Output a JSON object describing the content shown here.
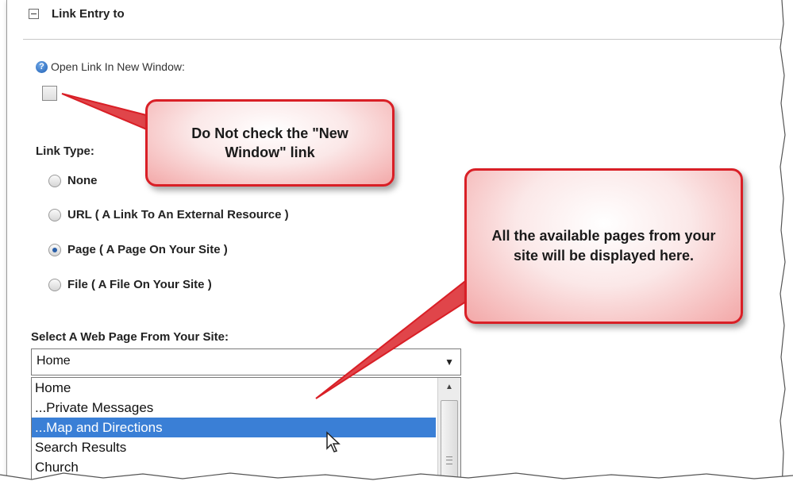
{
  "section": {
    "title": "Link Entry to",
    "collapse_icon": "minus-square-icon"
  },
  "new_window": {
    "label": "Open Link In New Window:",
    "help_icon": "question-circle-icon",
    "checked": false
  },
  "link_type": {
    "label": "Link Type:",
    "options": [
      {
        "label": "None",
        "selected": false
      },
      {
        "label": "URL ( A Link To An External Resource )",
        "selected": false
      },
      {
        "label": "Page ( A Page On Your Site )",
        "selected": true
      },
      {
        "label": "File ( A File On Your Site )",
        "selected": false
      }
    ]
  },
  "page_select": {
    "label": "Select A Web Page From Your Site:",
    "value": "Home",
    "options": [
      "Home",
      "...Private Messages",
      "...Map and Directions",
      "Search Results",
      "Church"
    ],
    "highlighted": "...Map and Directions"
  },
  "callouts": {
    "new_window": "Do Not check the \"New Window\" link",
    "pages": "All the available pages from your site will be displayed here."
  },
  "colors": {
    "callout_border": "#d91f26",
    "selection": "#3a7fd6"
  }
}
